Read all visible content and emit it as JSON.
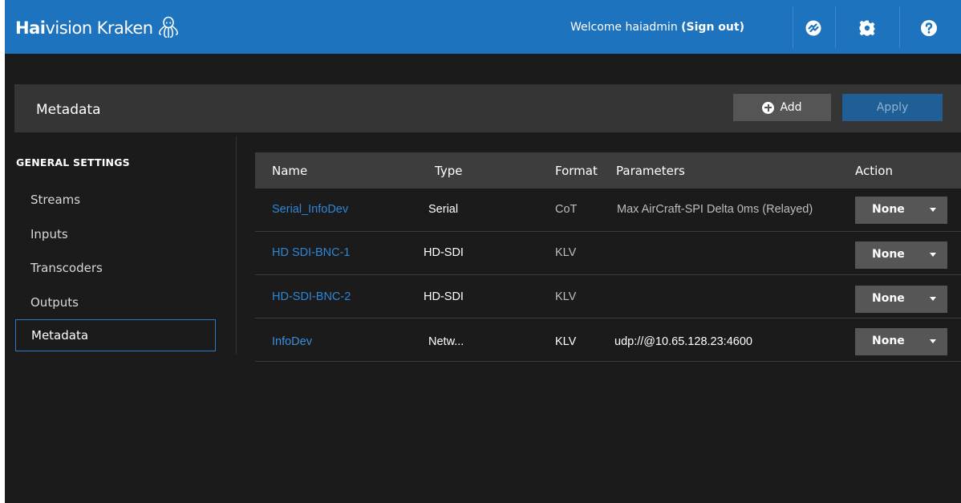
{
  "app": {
    "brand_bold": "Hai",
    "brand_regular": "vision",
    "brand_product": "Kraken",
    "logo_icon": "octopus-logo-icon"
  },
  "topbar": {
    "welcome_text": "Welcome haiadmin ",
    "signout_label": "(Sign out)",
    "icons": [
      "status-icon",
      "gear-icon",
      "help-icon"
    ],
    "accent_color": "#1e73be"
  },
  "header": {
    "title": "Metadata",
    "add_label": "Add",
    "apply_label": "Apply"
  },
  "sidebar": {
    "heading": "GENERAL SETTINGS",
    "items": [
      {
        "label": "Streams",
        "active": false
      },
      {
        "label": "Inputs",
        "active": false
      },
      {
        "label": "Transcoders",
        "active": false
      },
      {
        "label": "Outputs",
        "active": false
      },
      {
        "label": "Metadata",
        "active": true
      }
    ]
  },
  "table": {
    "columns": [
      "Name",
      "Type",
      "Format",
      "Parameters",
      "Action"
    ],
    "rows": [
      {
        "name": "Serial_InfoDev",
        "type": "Serial",
        "format": "CoT",
        "parameters": "Max AirCraft-SPI Delta 0ms (Relayed)",
        "action": "None"
      },
      {
        "name": "HD SDI-BNC-1",
        "type": "HD-SDI",
        "format": "KLV",
        "parameters": "",
        "action": "None"
      },
      {
        "name": "HD-SDI-BNC-2",
        "type": "HD-SDI",
        "format": "KLV",
        "parameters": "",
        "action": "None"
      },
      {
        "name": "InfoDev",
        "type": "Netw...",
        "format": "KLV",
        "parameters": "udp://@10.65.128.23:4600",
        "action": "None"
      }
    ]
  }
}
